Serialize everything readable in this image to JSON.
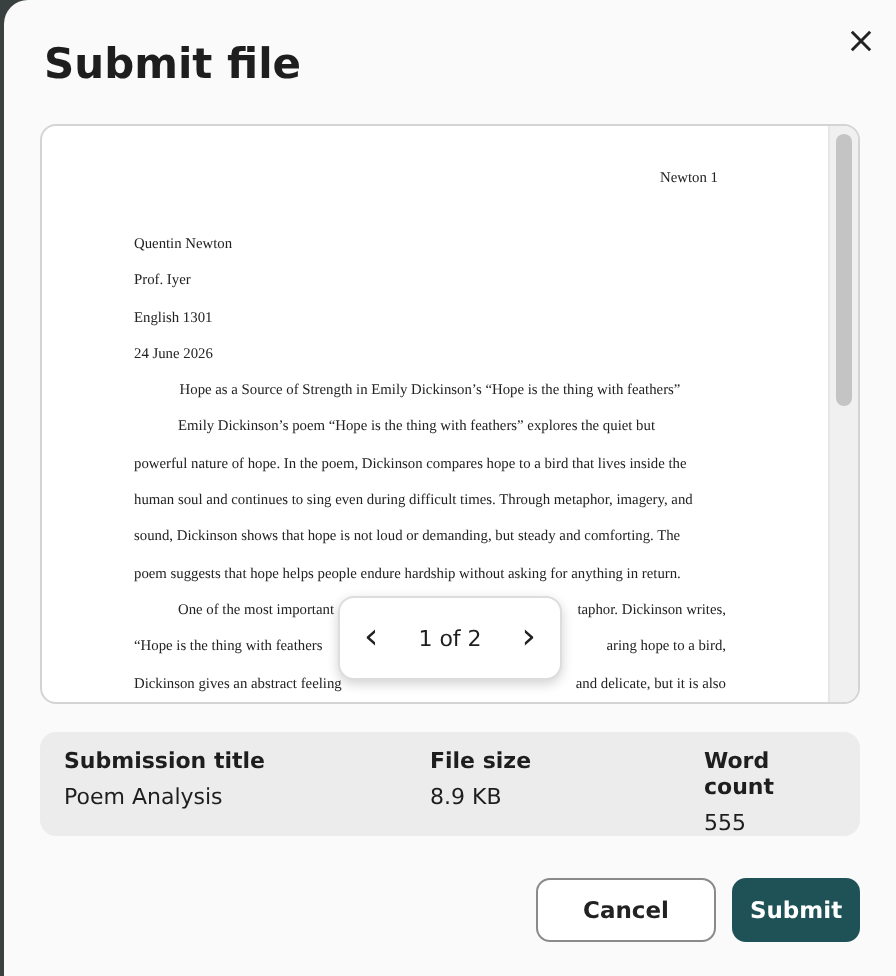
{
  "dialog": {
    "title": "Submit file"
  },
  "document": {
    "lines": [
      {
        "kind": "right",
        "text": "Newton 1"
      },
      {
        "kind": "left",
        "text": "Quentin Newton"
      },
      {
        "kind": "left",
        "text": "Prof. Iyer"
      },
      {
        "kind": "left",
        "text": "English 1301"
      },
      {
        "kind": "left",
        "text": "24 June 2026"
      },
      {
        "kind": "center",
        "text": "Hope as a Source of Strength in Emily Dickinson’s “Hope is the thing with feathers”"
      },
      {
        "kind": "indent",
        "text": "Emily Dickinson’s poem “Hope is the thing with feathers” explores the quiet but"
      },
      {
        "kind": "left",
        "text": "powerful nature of hope. In the poem, Dickinson compares hope to a bird that lives inside the"
      },
      {
        "kind": "left",
        "text": "human soul and continues to sing even during difficult times. Through metaphor, imagery, and"
      },
      {
        "kind": "left",
        "text": "sound, Dickinson shows that hope is not loud or demanding, but steady and comforting. The"
      },
      {
        "kind": "left",
        "text": "poem suggests that hope helps people endure hardship without asking for anything in return."
      },
      {
        "kind": "split-indent",
        "parts": [
          "One of the most important",
          "taphor. Dickinson writes,"
        ]
      },
      {
        "kind": "split",
        "parts": [
          "“Hope is the thing with feathers",
          "aring hope to a bird,"
        ]
      },
      {
        "kind": "split",
        "parts": [
          "Dickinson gives an abstract feeling",
          "and delicate, but it is also"
        ]
      }
    ]
  },
  "pager": {
    "prev": "‹",
    "label": "1 of 2",
    "next": "›"
  },
  "details": [
    {
      "label": "Submission title",
      "value": "Poem Analysis"
    },
    {
      "label": "File size",
      "value": "8.9 KB"
    },
    {
      "label": "Word count",
      "value": "555"
    }
  ],
  "buttons": [
    {
      "kind": "secondary",
      "label": "Cancel"
    },
    {
      "kind": "primary",
      "label": "Submit"
    }
  ]
}
